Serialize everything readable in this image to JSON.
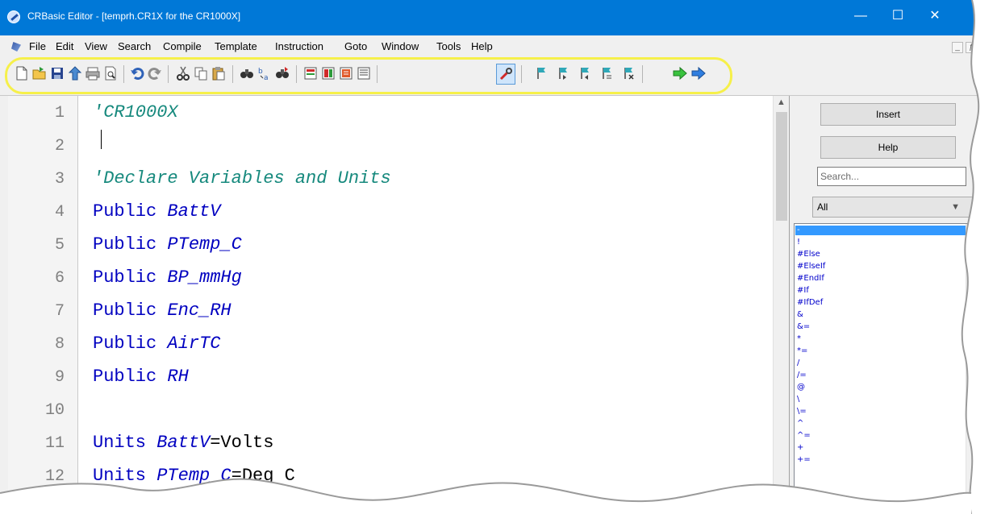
{
  "window": {
    "title": "CRBasic Editor - [temprh.CR1X for the CR1000X]",
    "controls": {
      "minimize": "—",
      "maximize": "☐",
      "close": "✕"
    }
  },
  "menu": {
    "items": [
      "File",
      "Edit",
      "View",
      "Search",
      "Compile",
      "Template",
      "Instruction",
      "Goto",
      "Window",
      "Tools",
      "Help"
    ],
    "mdi_minimize": "_",
    "mdi_restore": "ƒ",
    "mdi_close": "x"
  },
  "toolbar": {
    "icons": [
      "new-file-icon",
      "open-file-icon",
      "save-icon",
      "save-and-compile-icon",
      "print-icon",
      "print-preview-icon",
      "undo-icon",
      "redo-icon",
      "cut-icon",
      "copy-icon",
      "paste-icon",
      "find-icon",
      "replace-icon",
      "find-next-icon",
      "instruction-icon-1",
      "instruction-icon-2",
      "instruction-icon-3",
      "instruction-icon-4",
      "wrench-icon",
      "bookmark-icon",
      "bookmark-next-icon",
      "bookmark-prev-icon",
      "bookmark-list-icon",
      "bookmark-clear-icon",
      "arrow-green-icon",
      "arrow-blue-icon"
    ],
    "highlight_color": "#f6f04a"
  },
  "editor": {
    "line_numbers": [
      "1",
      "2",
      "3",
      "4",
      "5",
      "6",
      "7",
      "8",
      "9",
      "10",
      "11",
      "12"
    ],
    "lines": [
      {
        "parts": [
          {
            "cls": "cmt",
            "text": "'CR1000X"
          }
        ]
      },
      {
        "parts": []
      },
      {
        "parts": [
          {
            "cls": "cmt",
            "text": "'Declare Variables and Units"
          }
        ]
      },
      {
        "parts": [
          {
            "cls": "kw",
            "text": "Public "
          },
          {
            "cls": "var",
            "text": "BattV"
          }
        ]
      },
      {
        "parts": [
          {
            "cls": "kw",
            "text": "Public "
          },
          {
            "cls": "var",
            "text": "PTemp_C"
          }
        ]
      },
      {
        "parts": [
          {
            "cls": "kw",
            "text": "Public "
          },
          {
            "cls": "var",
            "text": "BP_mmHg"
          }
        ]
      },
      {
        "parts": [
          {
            "cls": "kw",
            "text": "Public "
          },
          {
            "cls": "var",
            "text": "Enc_RH"
          }
        ]
      },
      {
        "parts": [
          {
            "cls": "kw",
            "text": "Public "
          },
          {
            "cls": "var",
            "text": "AirTC"
          }
        ]
      },
      {
        "parts": [
          {
            "cls": "kw",
            "text": "Public "
          },
          {
            "cls": "var",
            "text": "RH"
          }
        ]
      },
      {
        "parts": []
      },
      {
        "parts": [
          {
            "cls": "kw",
            "text": "Units "
          },
          {
            "cls": "var",
            "text": "BattV"
          },
          {
            "cls": "plain",
            "text": "=Volts"
          }
        ]
      },
      {
        "parts": [
          {
            "cls": "kw",
            "text": "Units "
          },
          {
            "cls": "var",
            "text": "PTemp_C"
          },
          {
            "cls": "plain",
            "text": "=Deg C"
          }
        ]
      }
    ],
    "partial_line_text": "mmHg",
    "colors": {
      "keyword": "#0000c0",
      "comment": "#16897d"
    }
  },
  "panel": {
    "insert_label": "Insert",
    "help_label": "Help",
    "search_placeholder": "Search...",
    "category_value": "All",
    "instructions": [
      "-",
      "!",
      "#Else",
      "#ElseIf",
      "#EndIf",
      "#If",
      "#IfDef",
      "&",
      "&=",
      "*",
      "*=",
      "/",
      "/=",
      "@",
      "\\",
      "\\=",
      "^",
      "^=",
      "+",
      "+="
    ],
    "selected_index": 0
  }
}
